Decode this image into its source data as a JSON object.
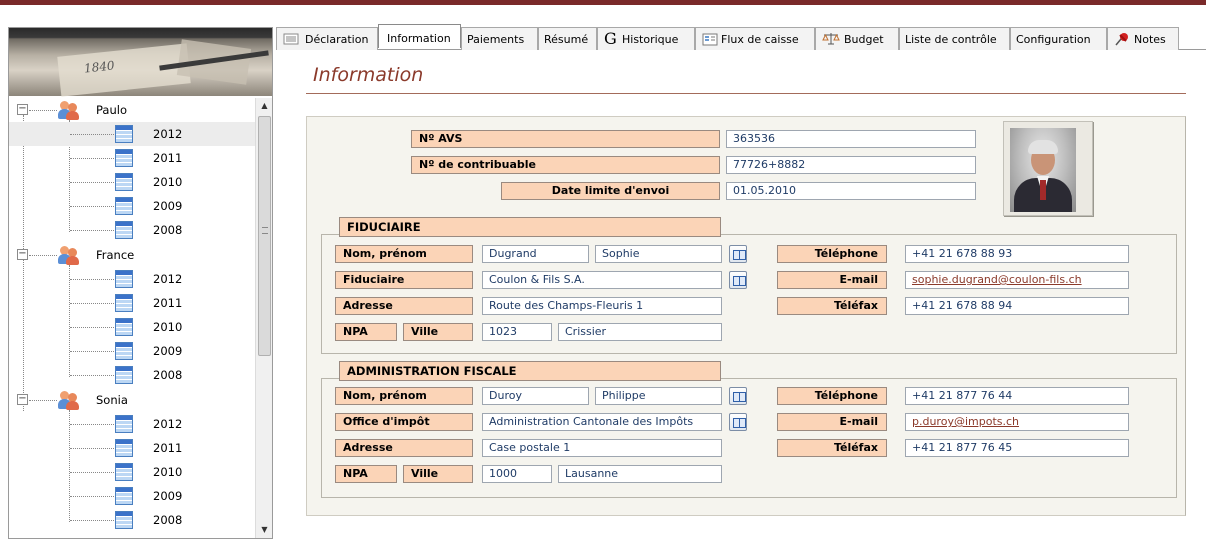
{
  "tabs": [
    {
      "label": "Déclaration",
      "icon": "list-icon"
    },
    {
      "label": "Information",
      "icon": ""
    },
    {
      "label": "Paiements",
      "icon": ""
    },
    {
      "label": "Résumé",
      "icon": ""
    },
    {
      "label": "Historique",
      "icon": "google-g-icon",
      "icon_glyph": "G"
    },
    {
      "label": "Flux de caisse",
      "icon": "cashflow-icon"
    },
    {
      "label": "Budget",
      "icon": "scale-icon"
    },
    {
      "label": "Liste de contrôle",
      "icon": ""
    },
    {
      "label": "Configuration",
      "icon": ""
    },
    {
      "label": "Notes",
      "icon": "pin-icon"
    }
  ],
  "active_tab": "Information",
  "page_title": "Information",
  "banner_number": "1840",
  "tree": {
    "people": [
      {
        "name": "Paulo",
        "expander": "−",
        "years": [
          "2012",
          "2011",
          "2010",
          "2009",
          "2008"
        ]
      },
      {
        "name": "France",
        "expander": "−",
        "years": [
          "2012",
          "2011",
          "2010",
          "2009",
          "2008"
        ]
      },
      {
        "name": "Sonia",
        "expander": "−",
        "years": [
          "2012",
          "2011",
          "2010",
          "2009",
          "2008"
        ]
      }
    ],
    "selected": "Paulo / 2012"
  },
  "scroll": {
    "up": "▲",
    "down": "▼"
  },
  "top_fields": {
    "avs": {
      "label": "Nº AVS",
      "value": "363536"
    },
    "contribuable": {
      "label": "Nº de contribuable",
      "value": "77726+8882"
    },
    "date_limite": {
      "label": "Date limite d'envoi",
      "value": "01.05.2010"
    }
  },
  "fiduciaire": {
    "header": "FIDUCIAIRE",
    "nom_label": "Nom, prénom",
    "nom": "Dugrand",
    "prenom": "Sophie",
    "org_label": "Fiduciaire",
    "org": "Coulon & Fils S.A.",
    "adresse_label": "Adresse",
    "adresse": "Route des Champs-Fleuris 1",
    "npa_label": "NPA",
    "ville_label": "Ville",
    "npa": "1023",
    "ville": "Crissier",
    "tel_label": "Téléphone",
    "tel": "+41 21 678 88 93",
    "email_label": "E-mail",
    "email": "sophie.dugrand@coulon-fils.ch",
    "fax_label": "Téléfax",
    "fax": "+41 21 678 88 94"
  },
  "administration": {
    "header": "ADMINISTRATION FISCALE",
    "nom_label": "Nom, prénom",
    "nom": "Duroy",
    "prenom": "Philippe",
    "org_label": "Office d'impôt",
    "org": "Administration Cantonale des Impôts",
    "adresse_label": "Adresse",
    "adresse": "Case postale 1",
    "npa_label": "NPA",
    "ville_label": "Ville",
    "npa": "1000",
    "ville": "Lausanne",
    "tel_label": "Téléphone",
    "tel": "+41 21 877 76 44",
    "email_label": "E-mail",
    "email": "p.duroy@impots.ch",
    "fax_label": "Téléfax",
    "fax": "+41 21 877 76 45"
  }
}
